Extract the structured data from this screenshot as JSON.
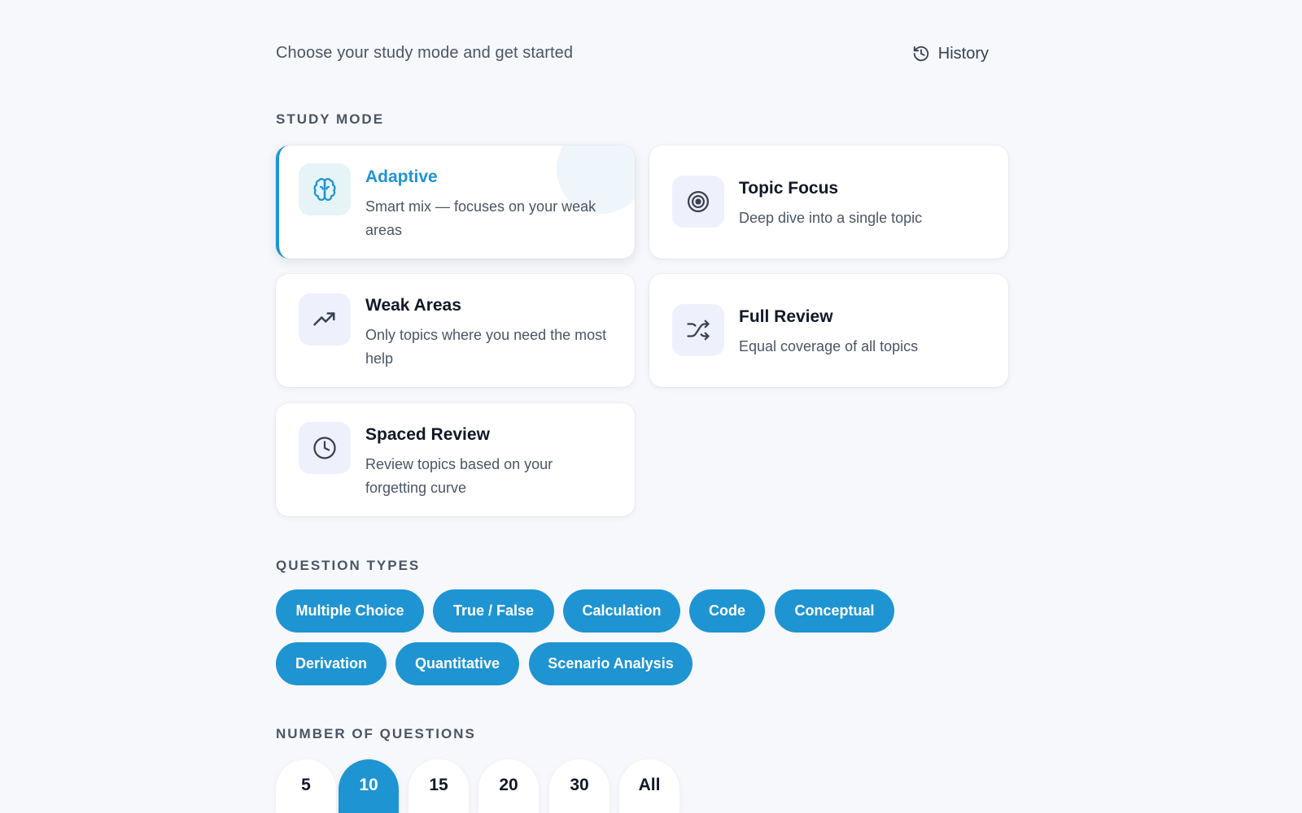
{
  "header": {
    "subtitle": "Choose your study mode and get started",
    "history_label": "History",
    "history_icon": "history-icon"
  },
  "study_mode": {
    "section_label": "STUDY MODE",
    "selected": "adaptive",
    "modes": [
      {
        "id": "adaptive",
        "title": "Adaptive",
        "description": "Smart mix — focuses on your weak areas",
        "icon": "brain-icon",
        "selected": true
      },
      {
        "id": "topic-focus",
        "title": "Topic Focus",
        "description": "Deep dive into a single topic",
        "icon": "target-icon",
        "selected": false
      },
      {
        "id": "weak-areas",
        "title": "Weak Areas",
        "description": "Only topics where you need the most help",
        "icon": "trending-up-icon",
        "selected": false
      },
      {
        "id": "full-review",
        "title": "Full Review",
        "description": "Equal coverage of all topics",
        "icon": "shuffle-icon",
        "selected": false
      },
      {
        "id": "spaced-review",
        "title": "Spaced Review",
        "description": "Review topics based on your forgetting curve",
        "icon": "clock-icon",
        "selected": false
      }
    ]
  },
  "question_types": {
    "section_label": "QUESTION TYPES",
    "types": [
      {
        "label": "Multiple Choice",
        "selected": true
      },
      {
        "label": "True / False",
        "selected": true
      },
      {
        "label": "Calculation",
        "selected": true
      },
      {
        "label": "Code",
        "selected": true
      },
      {
        "label": "Conceptual",
        "selected": true
      },
      {
        "label": "Derivation",
        "selected": true
      },
      {
        "label": "Quantitative",
        "selected": true
      },
      {
        "label": "Scenario Analysis",
        "selected": true
      }
    ]
  },
  "number_of_questions": {
    "section_label": "NUMBER OF QUESTIONS",
    "selected": "10",
    "options": [
      "5",
      "10",
      "15",
      "20",
      "30",
      "All"
    ]
  },
  "colors": {
    "accent": "#1f94d2",
    "background": "#f7f8fc",
    "card": "#ffffff",
    "icon_box": "#eef1fb"
  }
}
